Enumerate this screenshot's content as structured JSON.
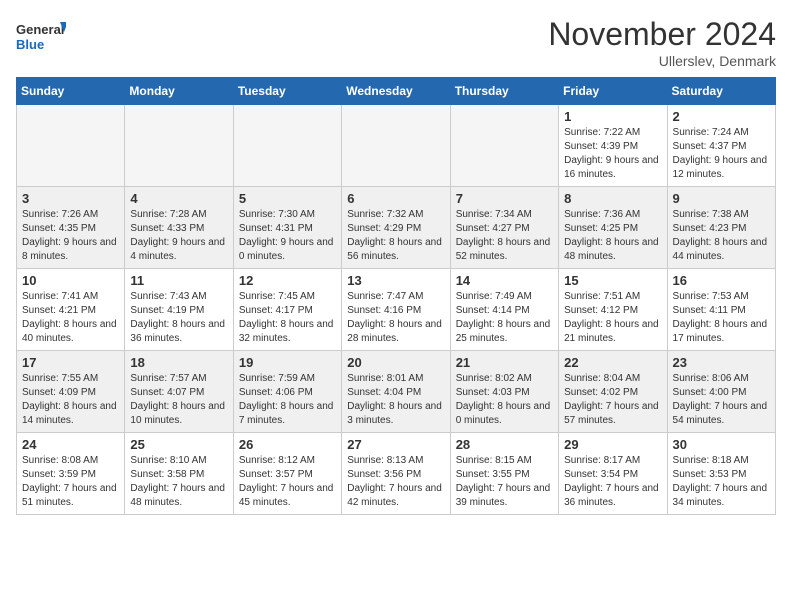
{
  "logo": {
    "line1": "General",
    "line2": "Blue"
  },
  "title": "November 2024",
  "location": "Ullerslev, Denmark",
  "days_of_week": [
    "Sunday",
    "Monday",
    "Tuesday",
    "Wednesday",
    "Thursday",
    "Friday",
    "Saturday"
  ],
  "weeks": [
    [
      {
        "day": "",
        "info": ""
      },
      {
        "day": "",
        "info": ""
      },
      {
        "day": "",
        "info": ""
      },
      {
        "day": "",
        "info": ""
      },
      {
        "day": "",
        "info": ""
      },
      {
        "day": "1",
        "info": "Sunrise: 7:22 AM\nSunset: 4:39 PM\nDaylight: 9 hours and 16 minutes."
      },
      {
        "day": "2",
        "info": "Sunrise: 7:24 AM\nSunset: 4:37 PM\nDaylight: 9 hours and 12 minutes."
      }
    ],
    [
      {
        "day": "3",
        "info": "Sunrise: 7:26 AM\nSunset: 4:35 PM\nDaylight: 9 hours and 8 minutes."
      },
      {
        "day": "4",
        "info": "Sunrise: 7:28 AM\nSunset: 4:33 PM\nDaylight: 9 hours and 4 minutes."
      },
      {
        "day": "5",
        "info": "Sunrise: 7:30 AM\nSunset: 4:31 PM\nDaylight: 9 hours and 0 minutes."
      },
      {
        "day": "6",
        "info": "Sunrise: 7:32 AM\nSunset: 4:29 PM\nDaylight: 8 hours and 56 minutes."
      },
      {
        "day": "7",
        "info": "Sunrise: 7:34 AM\nSunset: 4:27 PM\nDaylight: 8 hours and 52 minutes."
      },
      {
        "day": "8",
        "info": "Sunrise: 7:36 AM\nSunset: 4:25 PM\nDaylight: 8 hours and 48 minutes."
      },
      {
        "day": "9",
        "info": "Sunrise: 7:38 AM\nSunset: 4:23 PM\nDaylight: 8 hours and 44 minutes."
      }
    ],
    [
      {
        "day": "10",
        "info": "Sunrise: 7:41 AM\nSunset: 4:21 PM\nDaylight: 8 hours and 40 minutes."
      },
      {
        "day": "11",
        "info": "Sunrise: 7:43 AM\nSunset: 4:19 PM\nDaylight: 8 hours and 36 minutes."
      },
      {
        "day": "12",
        "info": "Sunrise: 7:45 AM\nSunset: 4:17 PM\nDaylight: 8 hours and 32 minutes."
      },
      {
        "day": "13",
        "info": "Sunrise: 7:47 AM\nSunset: 4:16 PM\nDaylight: 8 hours and 28 minutes."
      },
      {
        "day": "14",
        "info": "Sunrise: 7:49 AM\nSunset: 4:14 PM\nDaylight: 8 hours and 25 minutes."
      },
      {
        "day": "15",
        "info": "Sunrise: 7:51 AM\nSunset: 4:12 PM\nDaylight: 8 hours and 21 minutes."
      },
      {
        "day": "16",
        "info": "Sunrise: 7:53 AM\nSunset: 4:11 PM\nDaylight: 8 hours and 17 minutes."
      }
    ],
    [
      {
        "day": "17",
        "info": "Sunrise: 7:55 AM\nSunset: 4:09 PM\nDaylight: 8 hours and 14 minutes."
      },
      {
        "day": "18",
        "info": "Sunrise: 7:57 AM\nSunset: 4:07 PM\nDaylight: 8 hours and 10 minutes."
      },
      {
        "day": "19",
        "info": "Sunrise: 7:59 AM\nSunset: 4:06 PM\nDaylight: 8 hours and 7 minutes."
      },
      {
        "day": "20",
        "info": "Sunrise: 8:01 AM\nSunset: 4:04 PM\nDaylight: 8 hours and 3 minutes."
      },
      {
        "day": "21",
        "info": "Sunrise: 8:02 AM\nSunset: 4:03 PM\nDaylight: 8 hours and 0 minutes."
      },
      {
        "day": "22",
        "info": "Sunrise: 8:04 AM\nSunset: 4:02 PM\nDaylight: 7 hours and 57 minutes."
      },
      {
        "day": "23",
        "info": "Sunrise: 8:06 AM\nSunset: 4:00 PM\nDaylight: 7 hours and 54 minutes."
      }
    ],
    [
      {
        "day": "24",
        "info": "Sunrise: 8:08 AM\nSunset: 3:59 PM\nDaylight: 7 hours and 51 minutes."
      },
      {
        "day": "25",
        "info": "Sunrise: 8:10 AM\nSunset: 3:58 PM\nDaylight: 7 hours and 48 minutes."
      },
      {
        "day": "26",
        "info": "Sunrise: 8:12 AM\nSunset: 3:57 PM\nDaylight: 7 hours and 45 minutes."
      },
      {
        "day": "27",
        "info": "Sunrise: 8:13 AM\nSunset: 3:56 PM\nDaylight: 7 hours and 42 minutes."
      },
      {
        "day": "28",
        "info": "Sunrise: 8:15 AM\nSunset: 3:55 PM\nDaylight: 7 hours and 39 minutes."
      },
      {
        "day": "29",
        "info": "Sunrise: 8:17 AM\nSunset: 3:54 PM\nDaylight: 7 hours and 36 minutes."
      },
      {
        "day": "30",
        "info": "Sunrise: 8:18 AM\nSunset: 3:53 PM\nDaylight: 7 hours and 34 minutes."
      }
    ]
  ]
}
